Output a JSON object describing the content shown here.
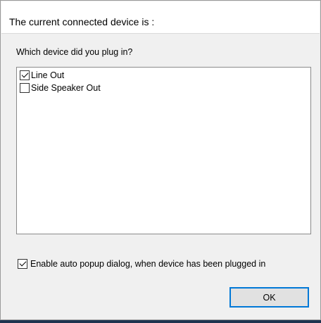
{
  "dialog": {
    "header_text": "The current connected device is :",
    "prompt": "Which device did you plug in?",
    "device_list": [
      {
        "label": "Line Out",
        "checked": true
      },
      {
        "label": "Side Speaker Out",
        "checked": false
      }
    ],
    "auto_popup": {
      "label": "Enable auto popup dialog, when device has been plugged in",
      "checked": true
    },
    "ok_label": "OK"
  },
  "colors": {
    "accent": "#0078d7",
    "dialog_bg": "#f0f0f0",
    "header_bg": "#ffffff"
  }
}
